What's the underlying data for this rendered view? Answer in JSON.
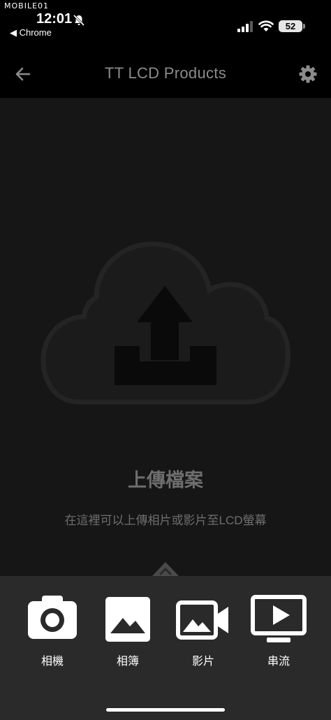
{
  "status_bar": {
    "watermark": "MOBILE01",
    "time": "12:01",
    "back_app": "◀ Chrome",
    "battery": "52",
    "icons": [
      "mute-bell-icon",
      "signal-icon",
      "wifi-icon",
      "battery-icon"
    ]
  },
  "nav": {
    "title": "TT LCD Products",
    "back_icon": "arrow-left-icon",
    "settings_icon": "gear-icon",
    "text_color": "#8b8b8b"
  },
  "main": {
    "illustration": "cloud-upload-icon",
    "title": "上傳檔案",
    "subtitle": "在這裡可以上傳相片或影片至LCD螢幕",
    "text_color": "#6e6e6e"
  },
  "actions": [
    {
      "label": "相機",
      "icon": "camera-icon"
    },
    {
      "label": "相簿",
      "icon": "photo-album-icon"
    },
    {
      "label": "影片",
      "icon": "video-camera-icon"
    },
    {
      "label": "串流",
      "icon": "streaming-play-icon"
    }
  ],
  "colors": {
    "background": "#161616",
    "header": "#000000",
    "sheet": "#2a2a2a",
    "icon": "#ffffff"
  }
}
